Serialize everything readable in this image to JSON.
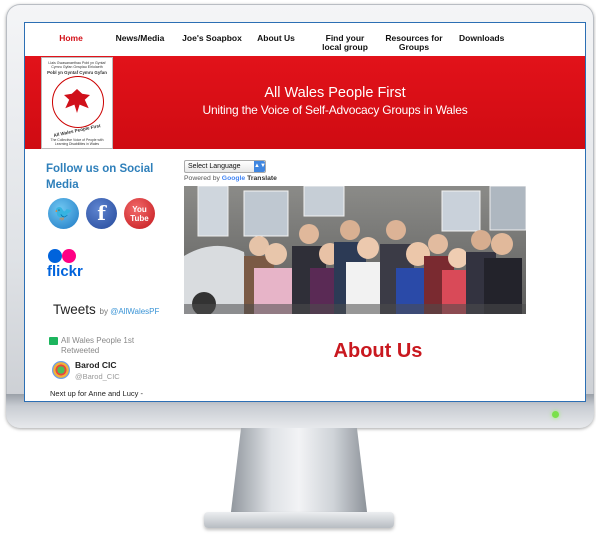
{
  "nav": {
    "items": [
      {
        "label": "Home",
        "active": true
      },
      {
        "label": "News/Media"
      },
      {
        "label": "Joe's Soapbox"
      },
      {
        "label": "About Us"
      },
      {
        "label": "Find your local group"
      },
      {
        "label": "Resources for Groups"
      },
      {
        "label": "Downloads"
      }
    ]
  },
  "banner": {
    "title": "All Wales People First",
    "subtitle": "Uniting the Voice of Self-Advocacy Groups in Wales",
    "logo_ring_top": "Pobl yn Gyntaf Cymru Gyfan",
    "logo_ring_bottom": "All Wales People First",
    "logo_text_top": "Llais Gwasanaethau Pobl yn Gyntaf Cymru Gyfan Grwpiau Eiriolaeth",
    "logo_text_bottom": "The Collective Voice of People with Learning Disabilities in Wales"
  },
  "sidebar": {
    "follow_title": "Follow us on Social Media",
    "social": [
      {
        "name": "twitter-icon",
        "glyph": "🐦"
      },
      {
        "name": "facebook-icon",
        "glyph": "f"
      },
      {
        "name": "youtube-icon",
        "glyph": "You\nTube"
      }
    ],
    "flickr_label": "flickr",
    "tweets_title": "Tweets",
    "tweets_by_prefix": "by",
    "tweets_handle": "@AllWalesPF",
    "retweet_text": "All Wales People 1st Retweeted",
    "tweet_author": "Barod CIC",
    "tweet_handle": "@Barod_CIC",
    "tweet_text": "Next up for Anne and Lucy -"
  },
  "main": {
    "language_select": "Select Language",
    "powered_prefix": "Powered by",
    "powered_google": "Google",
    "powered_translate": "Translate",
    "heading": "About Us"
  }
}
